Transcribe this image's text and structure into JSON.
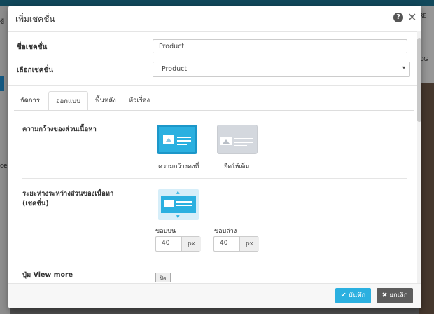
{
  "background": {
    "left_fragments": [
      "ข้",
      "ce"
    ],
    "right_fragments": [
      "RE",
      "OG"
    ]
  },
  "modal": {
    "title": "เพิ่มเชคชั่น",
    "help_glyph": "?",
    "close_glyph": "✕",
    "section_name_label": "ชื่อเชคชั่น",
    "section_name_value": "Product",
    "choose_section_label": "เลือกเชคชั่น",
    "choose_section_value": "Product",
    "caret_glyph": "▾"
  },
  "tabs": [
    {
      "label": "จัดการ"
    },
    {
      "label": "ออกแบบ"
    },
    {
      "label": "พื้นหลัง"
    },
    {
      "label": "หัวเรื่อง"
    }
  ],
  "active_tab": "ออกแบบ",
  "design": {
    "content_width_label": "ความกว้างของส่วนเนื้อหา",
    "width_options": [
      {
        "label": "ความกว้างคงที่",
        "selected": true
      },
      {
        "label": "ยืดให้เต็ม",
        "selected": false
      }
    ],
    "spacing_label_line1": "ระยะห่างระหว่างส่วนของเนื้อหา",
    "spacing_label_line2": "(เชคชั่น)",
    "top_margin_label": "ขอบบน",
    "top_margin_value": "40",
    "bottom_margin_label": "ขอบล่าง",
    "bottom_margin_value": "40",
    "unit": "px",
    "view_more_label": "ปุ่ม View more",
    "view_more_toggle": "ปิด"
  },
  "footer": {
    "save_label": "✔ บันทึก",
    "cancel_label": "✖ ยกเลิก"
  },
  "colors": {
    "accent": "#2bb0e0",
    "cancel": "#5d5d5d"
  }
}
